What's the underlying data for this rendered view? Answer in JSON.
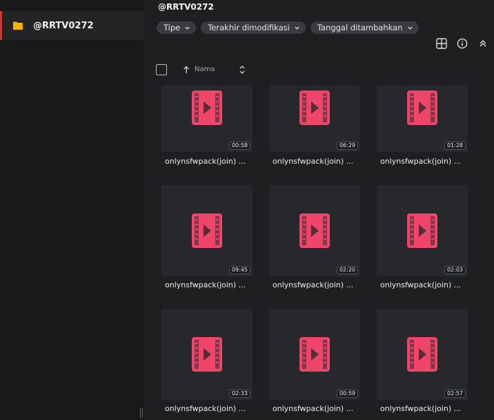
{
  "sidebar": {
    "folder_label": "@RRTV0272",
    "folder_color": "#f5b400",
    "active_indicator_color": "#d23a3a"
  },
  "header": {
    "title": "@RRTV0272"
  },
  "filters": [
    {
      "label": "Tipe"
    },
    {
      "label": "Terakhir dimodifikasi"
    },
    {
      "label": "Tanggal ditambahkan"
    }
  ],
  "toolbar": {
    "icons": [
      "grid-view-icon",
      "info-icon",
      "collapse-icon"
    ]
  },
  "list_header": {
    "name_column": "Nama",
    "sort": "ascending"
  },
  "accent_color": "#f0456b",
  "files": [
    {
      "name": "onlynsfwpack(join) ...",
      "duration": "00:58"
    },
    {
      "name": "onlynsfwpack(join) ...",
      "duration": "06:29"
    },
    {
      "name": "onlynsfwpack(join) ...",
      "duration": "01:28"
    },
    {
      "name": "onlynsfwpack(join) ...",
      "duration": "09:45"
    },
    {
      "name": "onlynsfwpack(join) ...",
      "duration": "02:20"
    },
    {
      "name": "onlynsfwpack(join) ...",
      "duration": "02:03"
    },
    {
      "name": "onlynsfwpack(join) ...",
      "duration": "02:33"
    },
    {
      "name": "onlynsfwpack(join) ...",
      "duration": "00:59"
    },
    {
      "name": "onlynsfwpack(join) ...",
      "duration": "02:57"
    }
  ]
}
